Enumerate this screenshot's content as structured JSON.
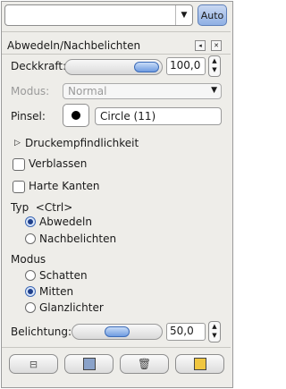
{
  "header": {
    "auto_label": "Auto"
  },
  "panel": {
    "title": "Abwedeln/Nachbelichten"
  },
  "opacity": {
    "label": "Deckkraft:",
    "value": "100,0",
    "fraction": 1.0
  },
  "mode": {
    "label": "Modus:",
    "value": "Normal"
  },
  "brush": {
    "label": "Pinsel:",
    "name": "Circle (11)"
  },
  "pressure": {
    "label": "Druckempfindlichkeit"
  },
  "fade": {
    "label": "Verblassen"
  },
  "hard_edges": {
    "label": "Harte Kanten"
  },
  "type": {
    "label": "Typ  <Ctrl>",
    "options": [
      "Abwedeln",
      "Nachbelichten"
    ],
    "selected": 0
  },
  "range": {
    "label": "Modus",
    "options": [
      "Schatten",
      "Mitten",
      "Glanzlichter"
    ],
    "selected": 1
  },
  "exposure": {
    "label": "Belichtung:",
    "value": "50,0",
    "fraction": 0.5
  },
  "footer_icons": [
    "save-icon",
    "restore-icon",
    "delete-icon",
    "reset-icon"
  ]
}
